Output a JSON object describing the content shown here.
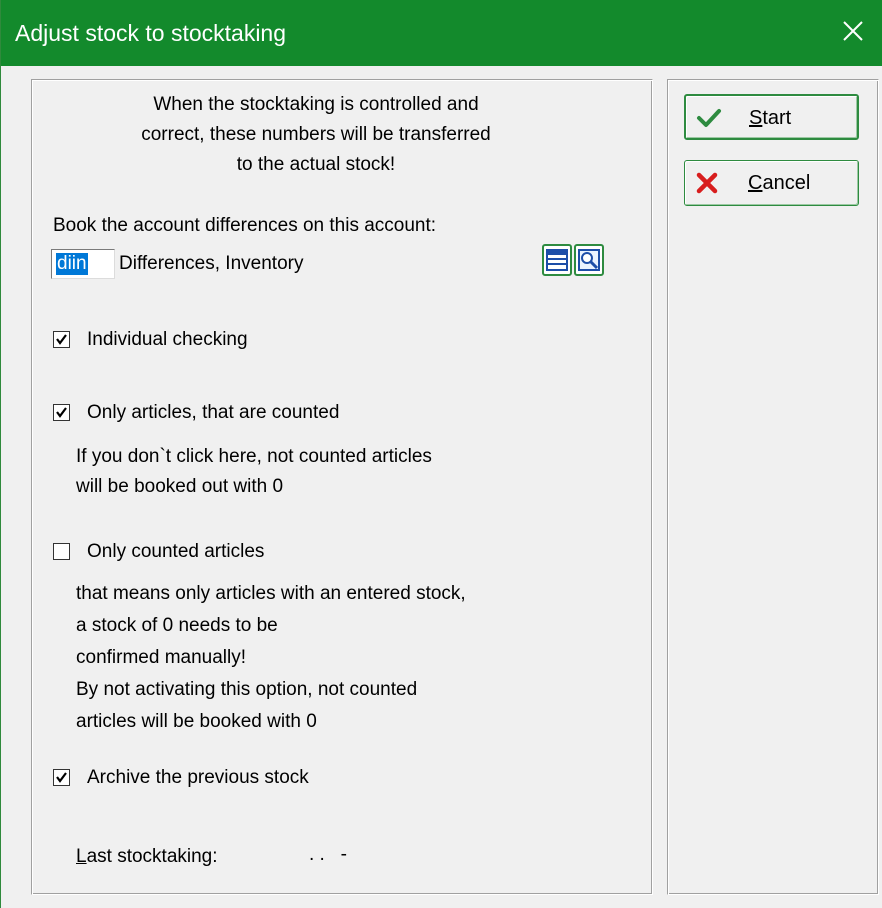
{
  "window": {
    "title": "Adjust stock to stocktaking"
  },
  "intro": {
    "line1": "When the stocktaking is controlled and",
    "line2": "correct, these numbers will be transferred",
    "line3": "to the actual stock!"
  },
  "account": {
    "label": "Book the account differences on this account:",
    "code": "diin",
    "name": "Differences, Inventory"
  },
  "options": {
    "individual_checking": {
      "label": "Individual checking",
      "checked": true
    },
    "only_articles_counted": {
      "label": "Only articles, that are counted",
      "checked": true,
      "help1": "If you don`t click here, not counted articles",
      "help2": "will be booked out with 0"
    },
    "only_counted_articles": {
      "label": "Only counted articles",
      "checked": false,
      "help1": "that means only articles with an entered stock,",
      "help2": "a stock of 0 needs to be",
      "help3": "confirmed manually!",
      "help4": "By not activating this option, not counted",
      "help5": "articles will be booked with 0"
    },
    "archive_previous": {
      "label": "Archive the previous stock",
      "checked": true
    }
  },
  "last_stocktaking": {
    "label_first": "L",
    "label_rest": "ast stocktaking:",
    "value": ". .   -"
  },
  "buttons": {
    "start_first": "S",
    "start_rest": "tart",
    "cancel_first": "C",
    "cancel_rest": "ancel"
  },
  "colors": {
    "titlebar": "#138a2c",
    "button_border": "#2e8b40",
    "selection": "#0078d7",
    "start_icon": "#2e8b40",
    "cancel_icon": "#d81e1e"
  },
  "icons": {
    "close": "close-icon",
    "start": "checkmark-icon",
    "cancel": "x-icon",
    "account_list": "list-icon",
    "account_search": "magnifier-icon"
  }
}
